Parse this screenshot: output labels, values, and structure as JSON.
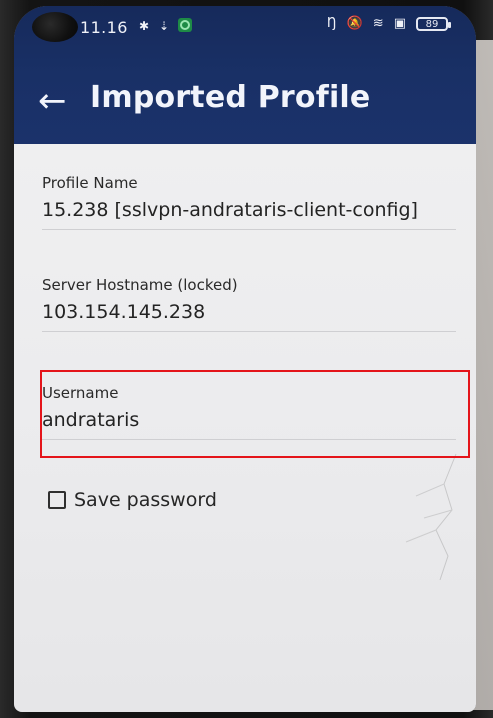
{
  "status_bar": {
    "time": "11.16",
    "left_icons": [
      "notification-dot-icon",
      "download-icon",
      "shield-icon"
    ],
    "right_icons": [
      "nfc-icon",
      "mute-icon",
      "wifi-icon",
      "sim-off-icon"
    ],
    "battery_level": "89"
  },
  "app_bar": {
    "back_icon": "back-arrow-icon",
    "title": "Imported Profile"
  },
  "form": {
    "profile_name_label": "Profile Name",
    "profile_name_value": "15.238 [sslvpn-andrataris-client-config]",
    "server_hostname_label": "Server Hostname (locked)",
    "server_hostname_value": "103.154.145.238",
    "username_label": "Username",
    "username_value": "andrataris",
    "save_password_label": "Save password"
  },
  "colors": {
    "app_bar_bg": "#1b326b",
    "content_bg": "#ecebec",
    "highlight_border": "#e4141a",
    "text_primary": "#232323",
    "underline": "#cfcfd2"
  }
}
